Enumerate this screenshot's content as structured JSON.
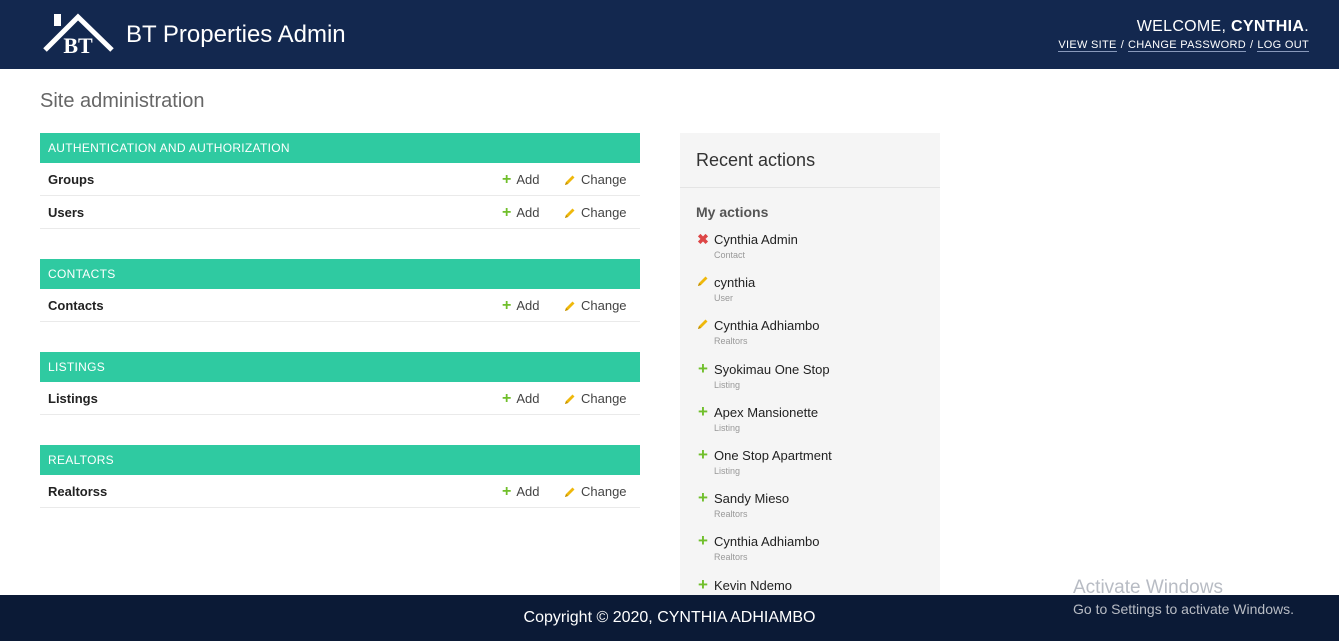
{
  "header": {
    "brand_logo_text": "BT",
    "brand_title": "BT Properties Admin",
    "welcome_prefix": "WELCOME,",
    "username": "CYNTHIA",
    "welcome_suffix": ".",
    "view_site": "VIEW SITE",
    "change_password": "CHANGE PASSWORD",
    "log_out": "LOG OUT",
    "separator": "/"
  },
  "page_title": "Site administration",
  "modules": [
    {
      "caption": "AUTHENTICATION AND AUTHORIZATION",
      "models": [
        {
          "name": "Groups",
          "add_label": "Add",
          "change_label": "Change"
        },
        {
          "name": "Users",
          "add_label": "Add",
          "change_label": "Change"
        }
      ]
    },
    {
      "caption": "CONTACTS",
      "models": [
        {
          "name": "Contacts",
          "add_label": "Add",
          "change_label": "Change"
        }
      ]
    },
    {
      "caption": "LISTINGS",
      "models": [
        {
          "name": "Listings",
          "add_label": "Add",
          "change_label": "Change"
        }
      ]
    },
    {
      "caption": "REALTORS",
      "models": [
        {
          "name": "Realtorss",
          "add_label": "Add",
          "change_label": "Change"
        }
      ]
    }
  ],
  "sidebar": {
    "title": "Recent actions",
    "subtitle": "My actions",
    "actions": [
      {
        "icon": "delete-icon",
        "name": "Cynthia Admin",
        "type": "Contact"
      },
      {
        "icon": "pencil-icon",
        "name": "cynthia",
        "type": "User"
      },
      {
        "icon": "pencil-icon",
        "name": "Cynthia Adhiambo",
        "type": "Realtors"
      },
      {
        "icon": "plus-icon",
        "name": "Syokimau One Stop",
        "type": "Listing"
      },
      {
        "icon": "plus-icon",
        "name": "Apex Mansionette",
        "type": "Listing"
      },
      {
        "icon": "plus-icon",
        "name": "One Stop Apartment",
        "type": "Listing"
      },
      {
        "icon": "plus-icon",
        "name": "Sandy Mieso",
        "type": "Realtors"
      },
      {
        "icon": "plus-icon",
        "name": "Cynthia Adhiambo",
        "type": "Realtors"
      },
      {
        "icon": "plus-icon",
        "name": "Kevin Ndemo",
        "type": ""
      }
    ]
  },
  "footer": {
    "copyright": "Copyright © 2020, CYNTHIA ADHIAMBO"
  },
  "watermark": {
    "title": "Activate Windows",
    "subtitle": "Go to Settings to activate Windows."
  },
  "colors": {
    "header_bg": "#13284f",
    "module_caption_bg": "#2fcaa1",
    "footer_bg": "#0b1a36",
    "add_green": "#70bf2b",
    "change_yellow": "#efb80b",
    "delete_red": "#dd4646"
  }
}
